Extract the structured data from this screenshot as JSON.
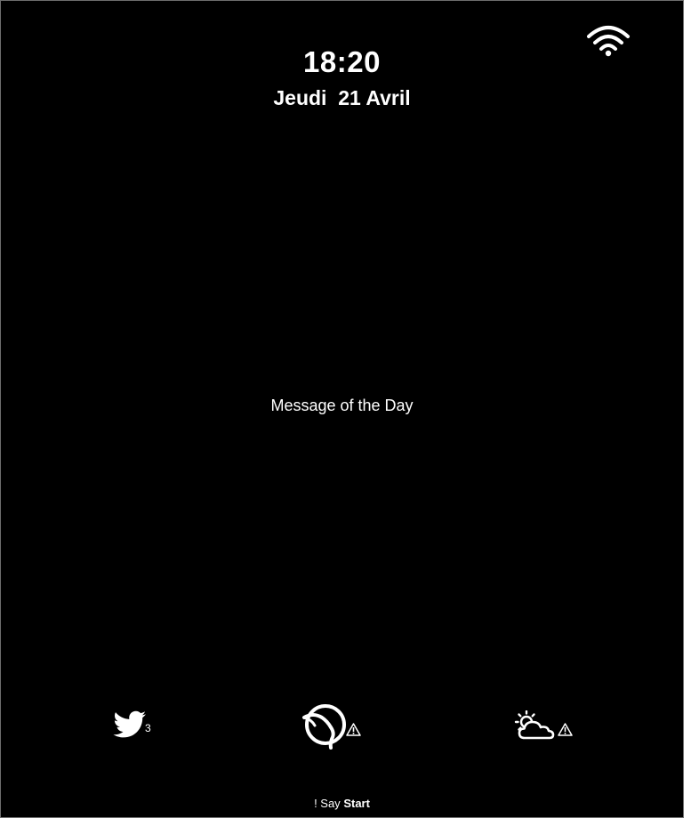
{
  "status": {
    "time": "18:20",
    "date": "Jeudi  21 Avril",
    "wifi_icon": "wifi-icon"
  },
  "main": {
    "message_of_the_day": "Message of the Day"
  },
  "dock": {
    "twitter": {
      "icon": "twitter-bird-icon",
      "count": "3"
    },
    "transit": {
      "icon": "ratp-logo-icon",
      "alert_icon": "warning-triangle-icon"
    },
    "weather": {
      "icon": "partly-cloudy-icon",
      "alert_icon": "warning-triangle-icon"
    }
  },
  "footer": {
    "prefix": "! Say",
    "command": "Start"
  },
  "colors": {
    "background": "#000000",
    "foreground": "#ffffff",
    "border": "#6e6e6e"
  }
}
